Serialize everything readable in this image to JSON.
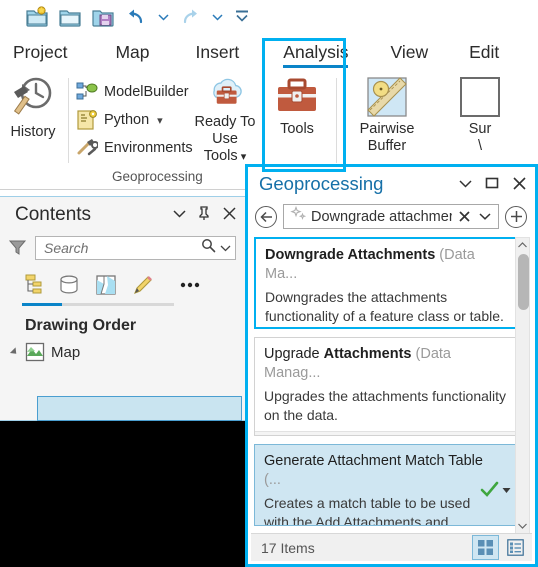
{
  "app": {
    "quick_access": [
      {
        "name": "new-project-icon",
        "label": "New Project"
      },
      {
        "name": "open-project-icon",
        "label": "Open Project"
      },
      {
        "name": "save-project-icon",
        "label": "Save Project"
      },
      {
        "name": "undo-icon",
        "label": "Undo"
      },
      {
        "name": "undo-dropdown-icon",
        "label": "Undo History"
      },
      {
        "name": "redo-icon",
        "label": "Redo"
      },
      {
        "name": "redo-dropdown-icon",
        "label": "Redo History"
      },
      {
        "name": "customize-qat-icon",
        "label": "Customize Quick Access Toolbar"
      }
    ]
  },
  "ribbon": {
    "tabs": [
      {
        "label": "Project",
        "selected": false
      },
      {
        "label": "Map",
        "selected": false
      },
      {
        "label": "Insert",
        "selected": false
      },
      {
        "label": "Analysis",
        "selected": true
      },
      {
        "label": "View",
        "selected": false
      },
      {
        "label": "Edit",
        "selected": false
      }
    ],
    "groups": [
      {
        "label": "Geoprocessing"
      }
    ],
    "buttons": {
      "history": "History",
      "modelbuilder": "ModelBuilder",
      "python": "Python",
      "environments": "Environments",
      "ready_to_use_tools_line1": "Ready To",
      "ready_to_use_tools_line2": "Use Tools",
      "tools": "Tools",
      "pairwise_line1": "Pairwise",
      "pairwise_line2": "Buffer",
      "summarize_line1": "Sur",
      "summarize_line2": "\\"
    }
  },
  "contents": {
    "title": "Contents",
    "search_placeholder": "Search",
    "drawing_order": "Drawing Order",
    "map_layer": "Map",
    "controls": [
      {
        "name": "contents-menu-icon",
        "glyph": "⌄"
      },
      {
        "name": "pin-icon",
        "glyph": "⤓"
      },
      {
        "name": "close-icon",
        "glyph": "✕"
      }
    ],
    "view_icons": [
      {
        "name": "list-by-drawing-order-icon"
      },
      {
        "name": "list-by-data-source-icon"
      },
      {
        "name": "list-by-snapshot-icon"
      },
      {
        "name": "list-by-editing-icon"
      },
      {
        "name": "more-options-icon"
      }
    ]
  },
  "geoprocessing": {
    "title": "Geoprocessing",
    "controls": [
      {
        "name": "panel-menu-icon",
        "glyph": "⌄"
      },
      {
        "name": "maximize-icon",
        "glyph": "□"
      },
      {
        "name": "close-icon",
        "glyph": "✕"
      }
    ],
    "search": {
      "value": "Downgrade attachmer",
      "back_label": "Back",
      "clear_label": "✕",
      "dropdown_label": "⌄",
      "add_label": "+"
    },
    "results": [
      {
        "title_prefix": "",
        "title_bold": "Downgrade Attachments",
        "title_rest": "",
        "category": "(Data Ma...",
        "description": "Downgrades the attachments functionality of a feature class or table.",
        "state": "selected",
        "tool_icon": "hammer-icon",
        "has_check": false
      },
      {
        "title_prefix": "Upgrade ",
        "title_bold": "Attachments",
        "title_rest": "",
        "category": "(Data Manag...",
        "description": "Upgrades the attachments functionality on the data.",
        "state": "normal",
        "tool_icon": "hammer-icon",
        "has_check": false
      },
      {
        "title_prefix": "Generate Attachment Match Table",
        "title_bold": "",
        "title_rest": "",
        "category": "(...",
        "description": "Creates a match table to be used with the Add Attachments and",
        "state": "hover",
        "tool_icon": "hammer-icon",
        "has_check": true
      }
    ],
    "footer": {
      "count": "17 Items",
      "grid_view": "grid-view-icon",
      "list_view": "list-view-icon"
    }
  },
  "colors": {
    "accent_cyan": "#00b0f0",
    "tab_blue": "#0a84c8",
    "panel_title_blue": "#1670a8",
    "hover_blue": "#cfe6f2",
    "toolbox_red": "#c05a3e",
    "check_green": "#3fa63f"
  }
}
